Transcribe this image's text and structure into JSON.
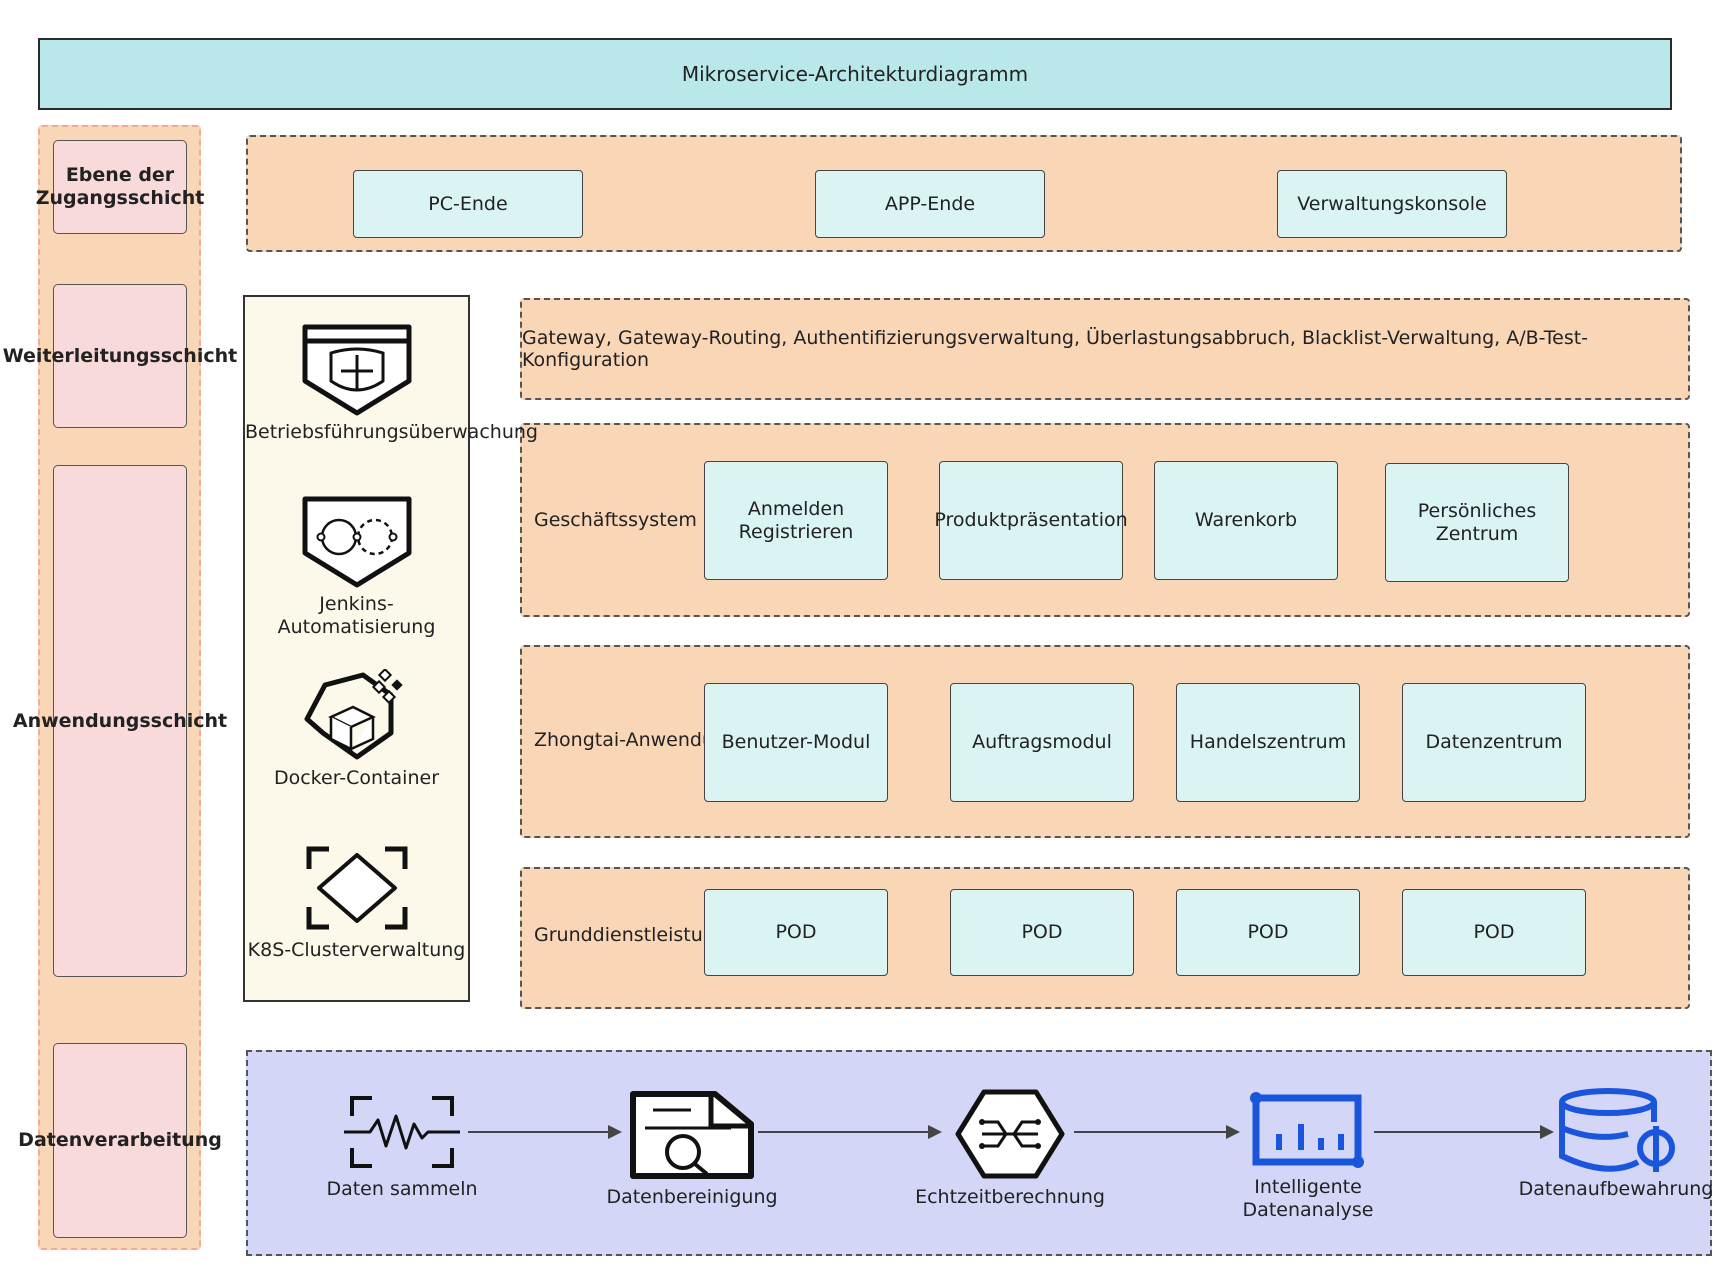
{
  "title": "Mikroservice-Architekturdiagramm",
  "layers": [
    "Ebene der Zugangsschicht",
    "Weiterleitungsschicht",
    "Anwendungsschicht",
    "Datenverarbeitung"
  ],
  "access": [
    "PC-Ende",
    "APP-Ende",
    "Verwaltungskonsole"
  ],
  "gateway": "Gateway, Gateway-Routing, Authentifizierungsverwaltung, Überlastungsabbruch, Blacklist-Verwaltung, A/B-Test-Konfiguration",
  "business": {
    "label": "Geschäftssystem",
    "items": [
      "Anmelden Registrieren",
      "Produktpräsentation",
      "Warenkorb",
      "Persönliches Zentrum"
    ]
  },
  "zhongtai": {
    "label": "Zhongtai-Anwendung",
    "items": [
      "Benutzer-Modul",
      "Auftragsmodul",
      "Handelszentrum",
      "Datenzentrum"
    ]
  },
  "basic": {
    "label": "Grunddienstleistung",
    "items": [
      "POD",
      "POD",
      "POD",
      "POD"
    ]
  },
  "ops": [
    {
      "label": "Betriebsführungsüberwachung",
      "icon": "shield-plus-icon"
    },
    {
      "label": "Jenkins-Automatisierung",
      "icon": "infinity-shield-icon"
    },
    {
      "label": "Docker-Container",
      "icon": "container-cube-icon"
    },
    {
      "label": "K8S-Clusterverwaltung",
      "icon": "diamond-frame-icon"
    }
  ],
  "dataflow": [
    {
      "label": "Daten sammeln",
      "icon": "waveform-icon"
    },
    {
      "label": "Datenbereinigung",
      "icon": "document-search-icon"
    },
    {
      "label": "Echtzeitberechnung",
      "icon": "hexagon-circuit-icon"
    },
    {
      "label": "Intelligente Datenanalyse",
      "icon": "bar-chart-icon"
    },
    {
      "label": "Datenaufbewahrung",
      "icon": "database-icon"
    }
  ],
  "colors": {
    "title_bg": "#b8e8ea",
    "panel_bg": "#f8d6b6",
    "layer_box": "#f9dada",
    "cell_bg": "#daf3f3",
    "ops_bg": "#fcf8ea",
    "data_bg": "#d3d6f7",
    "icon_blue": "#1a56db"
  }
}
